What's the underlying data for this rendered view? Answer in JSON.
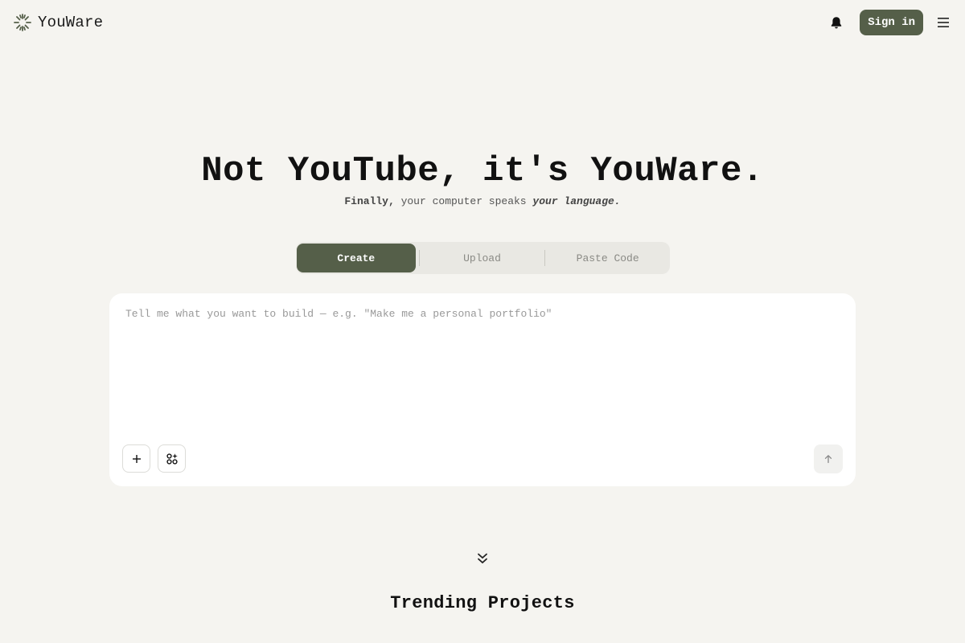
{
  "header": {
    "brand_name": "YouWare",
    "brand_icon": "youware-logo-icon",
    "notification_icon": "bell-icon",
    "signin_label": "Sign in",
    "menu_icon": "hamburger-menu-icon"
  },
  "hero": {
    "title": "Not YouTube, it's YouWare.",
    "subtitle_bold": "Finally,",
    "subtitle_plain": " your computer speaks ",
    "subtitle_italic": "your language."
  },
  "tabs": [
    {
      "label": "Create",
      "active": true
    },
    {
      "label": "Upload",
      "active": false
    },
    {
      "label": "Paste Code",
      "active": false
    }
  ],
  "prompt": {
    "placeholder": "Tell me what you want to build — e.g. \"Make me a personal portfolio\"",
    "value": "",
    "attach_icon": "plus-icon",
    "components_icon": "components-sparkle-icon",
    "send_icon": "arrow-up-icon"
  },
  "scroll_hint_icon": "double-chevron-down-icon",
  "trending": {
    "title": "Trending Projects"
  },
  "colors": {
    "accent": "#555f49",
    "background": "#f5f4f0",
    "tab_track": "#e9e8e3"
  }
}
